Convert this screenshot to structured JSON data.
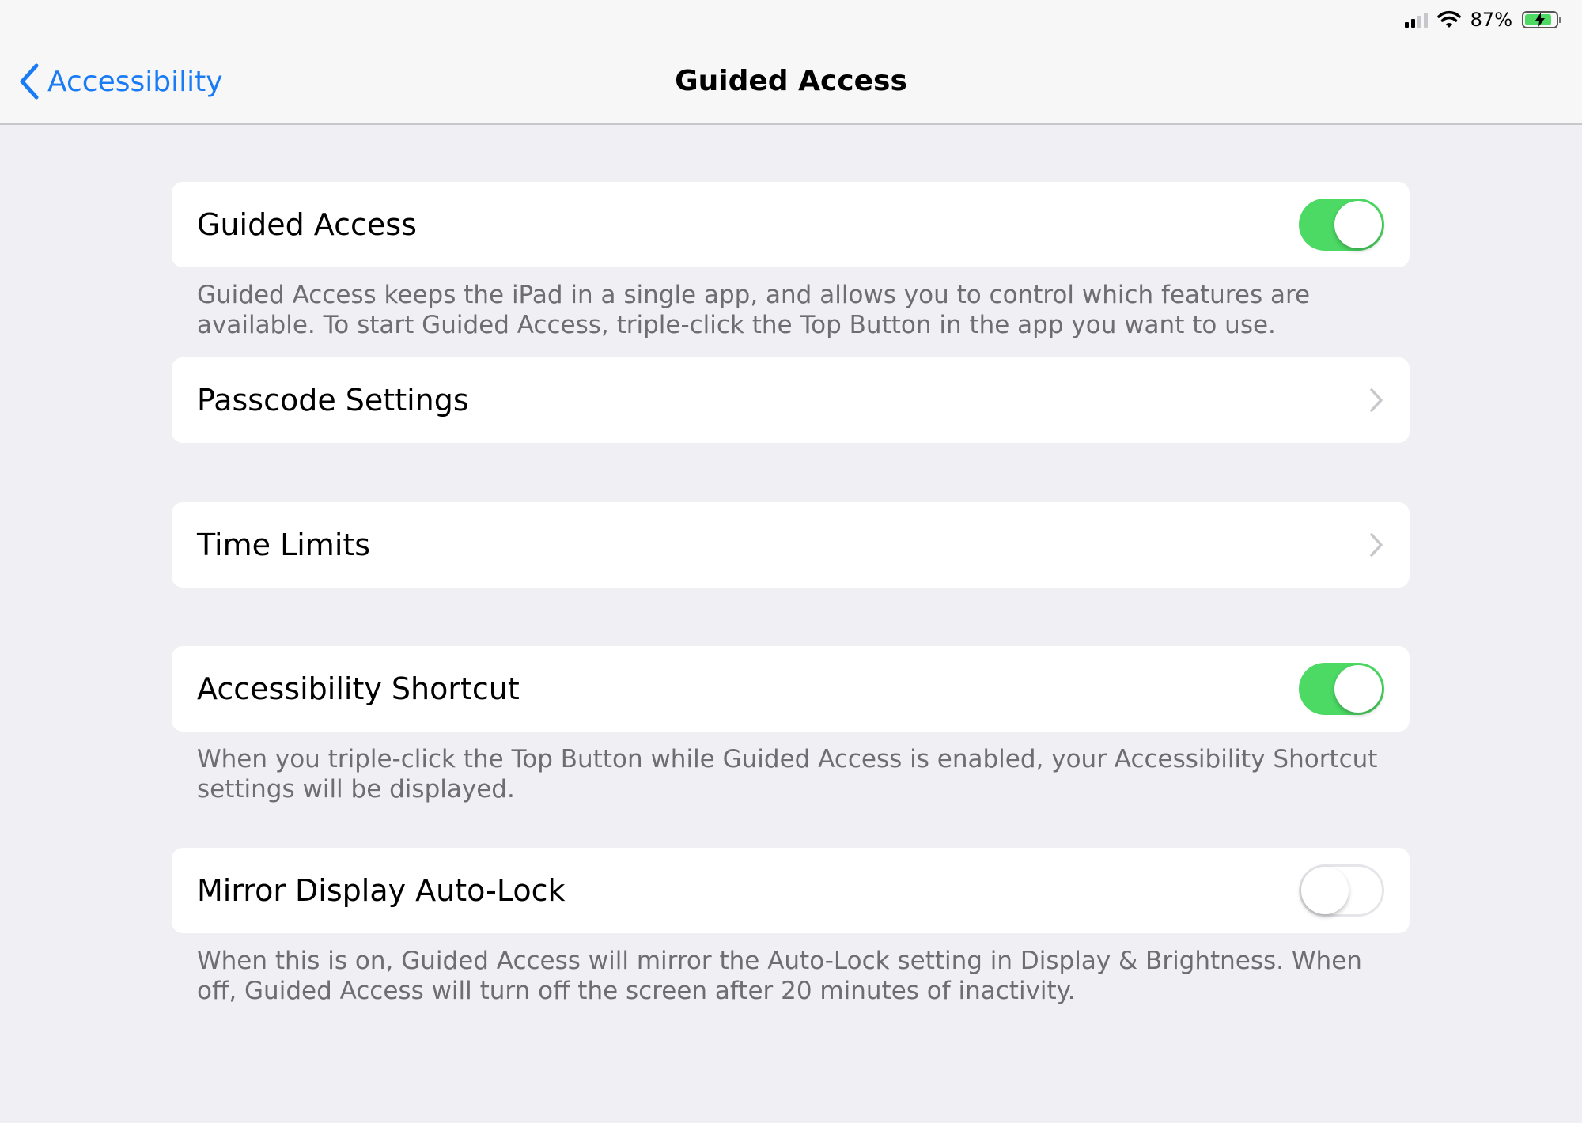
{
  "status_bar": {
    "battery_percent": "87%",
    "signal_bars_filled": 2,
    "signal_bars_total": 4,
    "wifi": "wifi-icon",
    "battery_level": 0.87,
    "charging": true
  },
  "nav": {
    "back_label": "Accessibility",
    "title": "Guided Access"
  },
  "rows": {
    "guided_access": {
      "label": "Guided Access",
      "enabled": true,
      "footer": "Guided Access keeps the iPad in a single app, and allows you to control which features are available. To start Guided Access, triple-click the Top Button in the app you want to use."
    },
    "passcode_settings": {
      "label": "Passcode Settings"
    },
    "time_limits": {
      "label": "Time Limits"
    },
    "accessibility_shortcut": {
      "label": "Accessibility Shortcut",
      "enabled": true,
      "footer": "When you triple-click the Top Button while Guided Access is enabled, your Accessibility Shortcut settings will be displayed."
    },
    "mirror_display_auto_lock": {
      "label": "Mirror Display Auto-Lock",
      "enabled": false,
      "footer": "When this is on, Guided Access will mirror the Auto-Lock setting in Display & Brightness. When off, Guided Access will turn off the screen after 20 minutes of inactivity."
    }
  },
  "colors": {
    "accent": "#1a7cf5",
    "toggle_on": "#4cd964",
    "background": "#efeff4",
    "footer_text": "#6d6d72"
  }
}
